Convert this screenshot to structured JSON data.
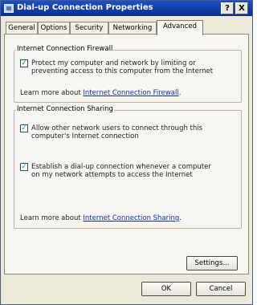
{
  "window": {
    "title": "Dial-up Connection Properties",
    "help_label": "?",
    "close_label": "X"
  },
  "tabs": [
    {
      "label": "General"
    },
    {
      "label": "Options"
    },
    {
      "label": "Security"
    },
    {
      "label": "Networking"
    },
    {
      "label": "Advanced"
    }
  ],
  "firewall": {
    "legend": "Internet Connection Firewall",
    "option_label": "Protect my computer and network by limiting or preventing access to this computer from the Internet",
    "checked": true,
    "learn_prefix": "Learn more about ",
    "learn_link": "Internet Connection Firewall",
    "learn_suffix": "."
  },
  "sharing": {
    "legend": "Internet Connection Sharing",
    "allow_label": "Allow other network users to connect through this computer's Internet connection",
    "allow_checked": true,
    "dial_label": "Establish a dial-up connection whenever a computer on my network attempts to access the Internet",
    "dial_checked": true,
    "learn_prefix": "Learn more about ",
    "learn_link": "Internet Connection Sharing",
    "learn_suffix": "."
  },
  "buttons": {
    "settings": "Settings...",
    "ok": "OK",
    "cancel": "Cancel"
  },
  "colors": {
    "titlebar": "#0a2f8e",
    "link": "#0b2fb8",
    "check": "#21a121"
  }
}
